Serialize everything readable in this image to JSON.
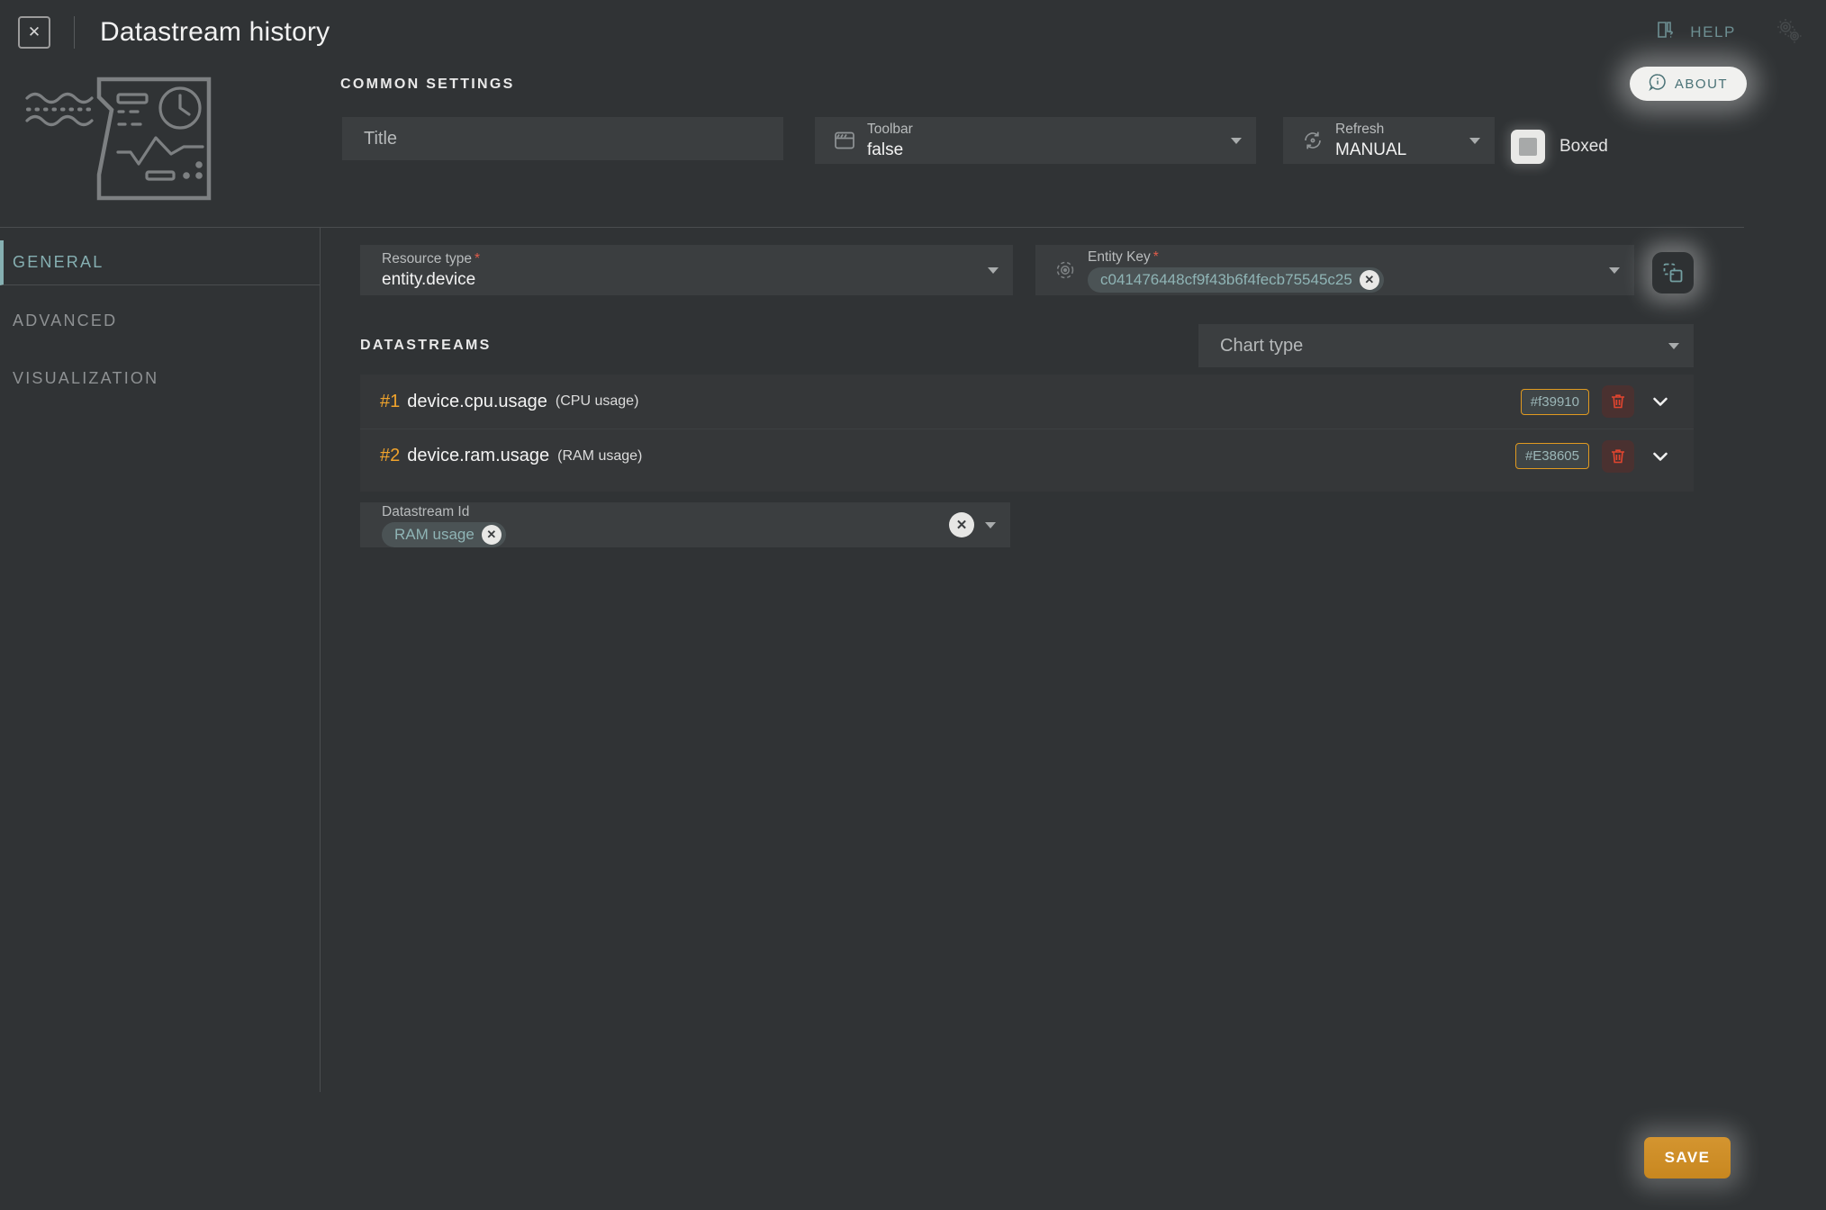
{
  "window": {
    "title": "Datastream history",
    "close_icon": "close-box-icon"
  },
  "topbar": {
    "help_label": "HELP",
    "help_icon": "book-question-icon",
    "gears_icon": "gears-icon"
  },
  "about": {
    "label": "ABOUT",
    "icon": "info-circle-icon"
  },
  "illustration": {
    "icon": "datastream-history-chart-illustration"
  },
  "common_settings": {
    "section_label": "COMMON SETTINGS",
    "title_field": {
      "placeholder": "Title",
      "value": ""
    },
    "toolbar_field": {
      "label": "Toolbar",
      "value": "false",
      "icon": "toolbar-icon"
    },
    "refresh_field": {
      "label": "Refresh",
      "value": "MANUAL",
      "icon": "refresh-icon"
    },
    "boxed_checkbox": {
      "label": "Boxed",
      "checked": true
    }
  },
  "sidebar": {
    "items": [
      {
        "label": "GENERAL",
        "active": true
      },
      {
        "label": "ADVANCED",
        "active": false
      },
      {
        "label": "VISUALIZATION",
        "active": false
      }
    ]
  },
  "main": {
    "resource_type": {
      "label": "Resource type",
      "required_marker": "*",
      "value": "entity.device"
    },
    "entity_key": {
      "label": "Entity Key",
      "required_marker": "*",
      "icon": "target-icon",
      "chip_value": "c041476448cf9f43b6f4fecb75545c25",
      "chip_remove_icon": "close-circle-icon"
    },
    "copy_button": {
      "icon": "copy-duplicate-icon"
    },
    "datastreams_label": "DATASTREAMS",
    "chart_type": {
      "placeholder": "Chart type",
      "value": ""
    },
    "datastreams": [
      {
        "index": "#1",
        "key": "device.cpu.usage",
        "alias": "(CPU usage)",
        "color": "#f39910",
        "delete_icon": "trash-icon",
        "expand_icon": "chevron-down-icon"
      },
      {
        "index": "#2",
        "key": "device.ram.usage",
        "alias": "(RAM usage)",
        "color": "#E38605",
        "delete_icon": "trash-icon",
        "expand_icon": "chevron-down-icon"
      }
    ],
    "datastream_id": {
      "label": "Datastream Id",
      "chip_value": "RAM usage",
      "chip_remove_icon": "close-circle-icon",
      "clear_icon": "close-circle-icon"
    }
  },
  "footer": {
    "save_label": "SAVE"
  },
  "colors": {
    "background": "#303335",
    "field_bg": "#3b3e40",
    "accent_teal": "#86b0b2",
    "accent_orange": "#f0a32c",
    "save_orange": "#c8871f",
    "required_red": "#e05c4a"
  }
}
